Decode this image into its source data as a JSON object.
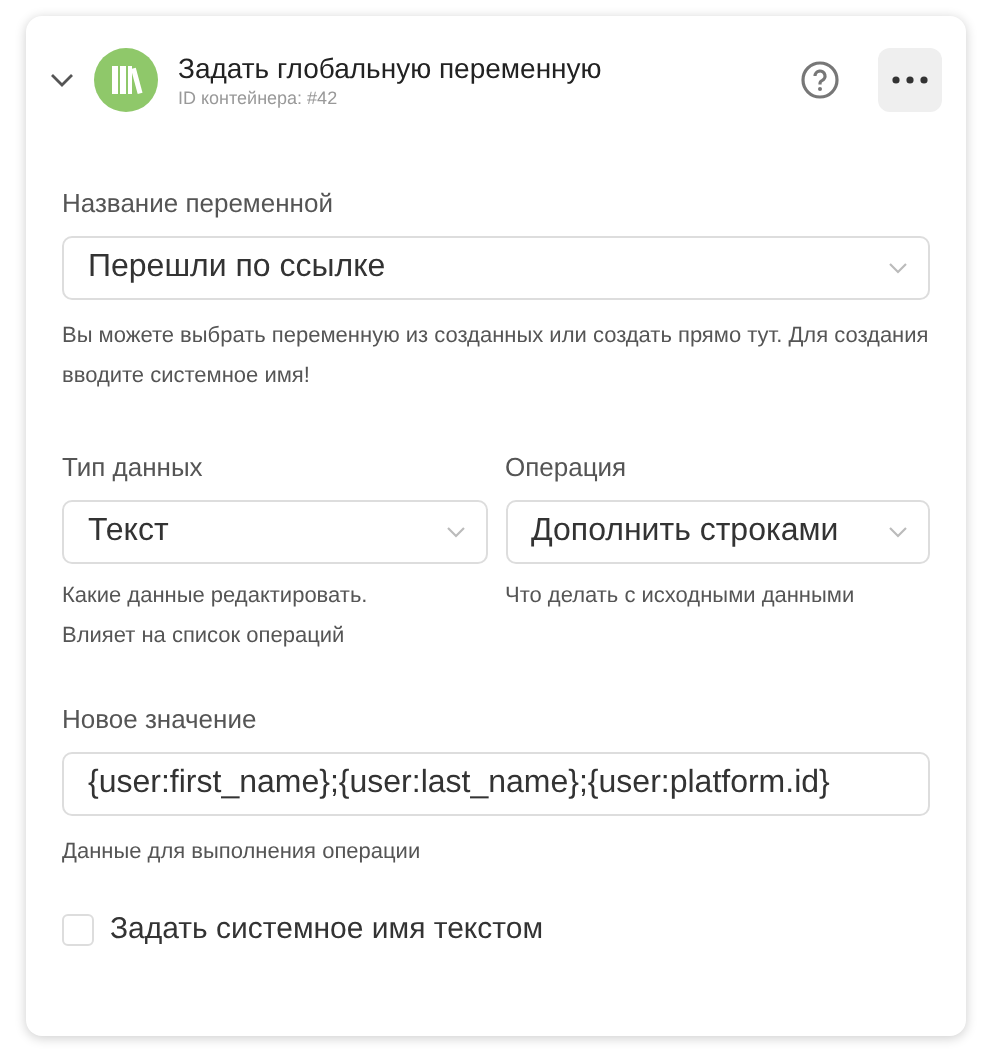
{
  "header": {
    "expanded": true,
    "title": "Задать глобальную переменную",
    "subtitle": "ID контейнера: #42"
  },
  "variable": {
    "label": "Название переменной",
    "value": "Перешли по ссылке",
    "hint": "Вы можете выбрать переменную из созданных или создать прямо тут. Для создания вводите системное имя!"
  },
  "columns": [
    {
      "label": "Тип данных",
      "value": "Текст",
      "hint_lines": [
        "Какие данные редактировать.",
        "Влияет на список операций"
      ]
    },
    {
      "label": "Операция",
      "value": "Дополнить строками",
      "hint_lines": [
        "Что делать с исходными данными"
      ]
    }
  ],
  "new_value": {
    "label": "Новое значение",
    "value": "{user:first_name};{user:last_name};{user:platform.id}",
    "hint": "Данные для выполнения операции"
  },
  "checkbox": {
    "label": "Задать системное имя текстом",
    "checked": false
  }
}
